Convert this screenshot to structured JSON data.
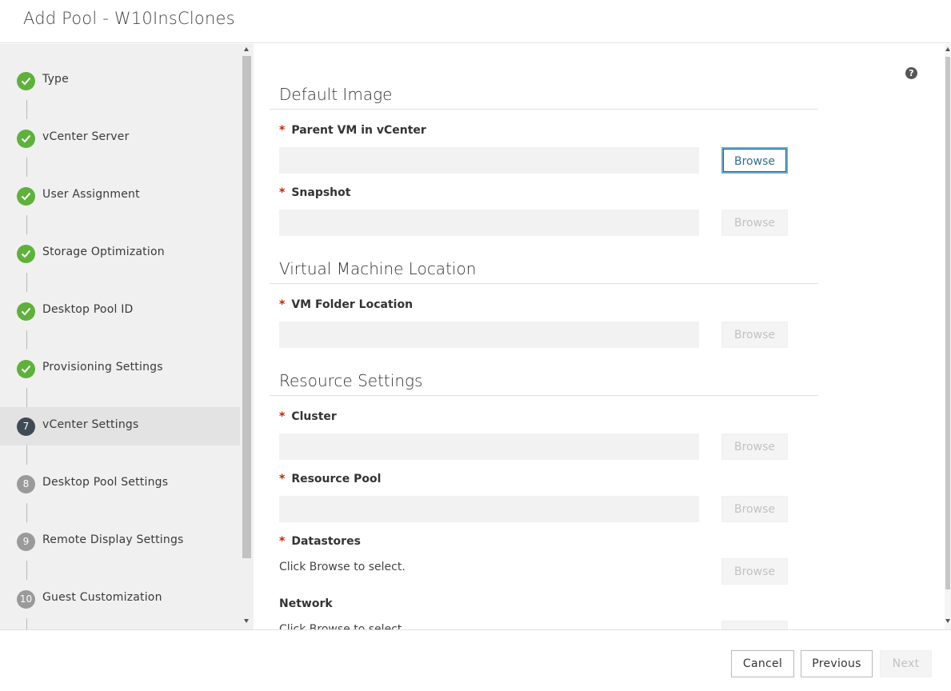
{
  "header": {
    "title": "Add Pool - W10InsClones"
  },
  "sidebar": {
    "steps": [
      {
        "label": "Type",
        "status": "done",
        "number": ""
      },
      {
        "label": "vCenter Server",
        "status": "done",
        "number": ""
      },
      {
        "label": "User Assignment",
        "status": "done",
        "number": ""
      },
      {
        "label": "Storage Optimization",
        "status": "done",
        "number": ""
      },
      {
        "label": "Desktop Pool ID",
        "status": "done",
        "number": ""
      },
      {
        "label": "Provisioning Settings",
        "status": "done",
        "number": ""
      },
      {
        "label": "vCenter Settings",
        "status": "current",
        "number": "7"
      },
      {
        "label": "Desktop Pool Settings",
        "status": "todo",
        "number": "8"
      },
      {
        "label": "Remote Display Settings",
        "status": "todo",
        "number": "9"
      },
      {
        "label": "Guest Customization",
        "status": "todo",
        "number": "10"
      }
    ]
  },
  "main": {
    "help_icon": "?",
    "sections": {
      "default_image": "Default Image",
      "vm_location": "Virtual Machine Location",
      "resource_settings": "Resource Settings"
    },
    "required_marker": "*",
    "fields": {
      "parent_vm": {
        "label": "Parent VM in vCenter",
        "value": "",
        "browse": "Browse"
      },
      "snapshot": {
        "label": "Snapshot",
        "value": "",
        "browse": "Browse"
      },
      "vm_folder": {
        "label": "VM Folder Location",
        "value": "",
        "browse": "Browse"
      },
      "cluster": {
        "label": "Cluster",
        "value": "",
        "browse": "Browse"
      },
      "resource_pool": {
        "label": "Resource Pool",
        "value": "",
        "browse": "Browse"
      },
      "datastores": {
        "label": "Datastores",
        "hint": "Click Browse to select.",
        "browse": "Browse"
      },
      "network": {
        "label": "Network",
        "hint": "Click Browse to select."
      }
    }
  },
  "footer": {
    "cancel": "Cancel",
    "previous": "Previous",
    "next": "Next"
  },
  "colors": {
    "done": "#5eb13b",
    "current": "#3f4a57",
    "todo": "#9a9a9a",
    "required": "#c92100",
    "accent": "#0072a3"
  }
}
